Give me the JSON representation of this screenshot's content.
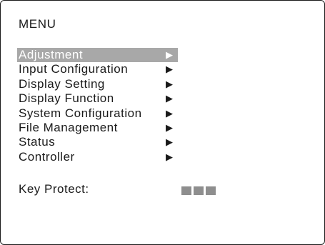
{
  "menu": {
    "title": "MENU",
    "items": [
      {
        "label": "Adjustment",
        "arrow": "▶",
        "selected": true
      },
      {
        "label": "Input Configuration",
        "arrow": "▶",
        "selected": false
      },
      {
        "label": "Display Setting",
        "arrow": "▶",
        "selected": false
      },
      {
        "label": "Display Function",
        "arrow": "▶",
        "selected": false
      },
      {
        "label": "System Configuration",
        "arrow": "▶",
        "selected": false
      },
      {
        "label": "File Management",
        "arrow": "▶",
        "selected": false
      },
      {
        "label": "Status",
        "arrow": "▶",
        "selected": false
      },
      {
        "label": "Controller",
        "arrow": "▶",
        "selected": false
      }
    ]
  },
  "key_protect": {
    "label": "Key Protect:",
    "indicator_blocks": 3
  },
  "colors": {
    "highlight": "#a8a8a8",
    "indicator": "#8e8e8e",
    "text": "#1a1a1a"
  }
}
